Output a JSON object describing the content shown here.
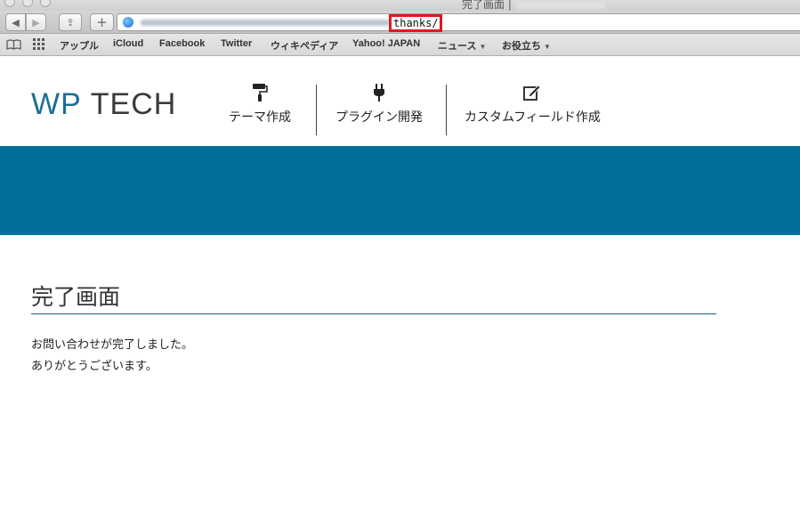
{
  "window": {
    "title": "完了画面 |"
  },
  "toolbar": {
    "back_label": "◀",
    "forward_label": "▶",
    "share_label": "⇪",
    "new_tab_label": "+",
    "url_visible_path": "thanks/"
  },
  "bookmarks": {
    "items": [
      {
        "label": "アップル"
      },
      {
        "label": "iCloud"
      },
      {
        "label": "Facebook"
      },
      {
        "label": "Twitter"
      },
      {
        "label": "ウィキペディア"
      },
      {
        "label": "Yahoo! JAPAN"
      },
      {
        "label": "ニュース",
        "dropdown": true
      },
      {
        "label": "お役立ち",
        "dropdown": true
      }
    ]
  },
  "site": {
    "logo_wp": "WP",
    "logo_tech": "TECH",
    "nav": [
      {
        "label": "テーマ作成",
        "icon": "paint-roller-icon"
      },
      {
        "label": "プラグイン開発",
        "icon": "plug-icon"
      },
      {
        "label": "カスタムフィールド作成",
        "icon": "edit-icon"
      }
    ],
    "hero_color": "#006f9a"
  },
  "content": {
    "title": "完了画面",
    "line1": "お問い合わせが完了しました。",
    "line2": "ありがとうございます。"
  }
}
